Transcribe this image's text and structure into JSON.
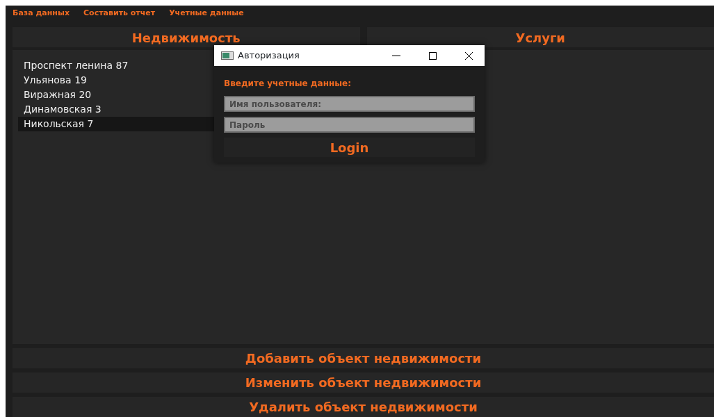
{
  "menu": [
    "База данных",
    "Составить отчет",
    "Учетные данные"
  ],
  "tabs": [
    {
      "label": "Недвижимость"
    },
    {
      "label": "Услуги"
    }
  ],
  "properties": [
    {
      "text": "Проспект ленина 87",
      "selected": false
    },
    {
      "text": "Ульянова 19",
      "selected": false
    },
    {
      "text": "Виражная 20",
      "selected": false
    },
    {
      "text": "Динамовская 3",
      "selected": false
    },
    {
      "text": "Никольская 7",
      "selected": true
    }
  ],
  "actions": [
    "Добавить объект недвижимости",
    "Изменить объект недвижимости",
    "Удалить объект недвижимости"
  ],
  "dialog": {
    "title": "Авторизация",
    "prompt": "Введите учетные данные:",
    "username": {
      "placeholder": "Имя пользователя:"
    },
    "password": {
      "placeholder": "Пароль"
    },
    "button": "Login"
  }
}
